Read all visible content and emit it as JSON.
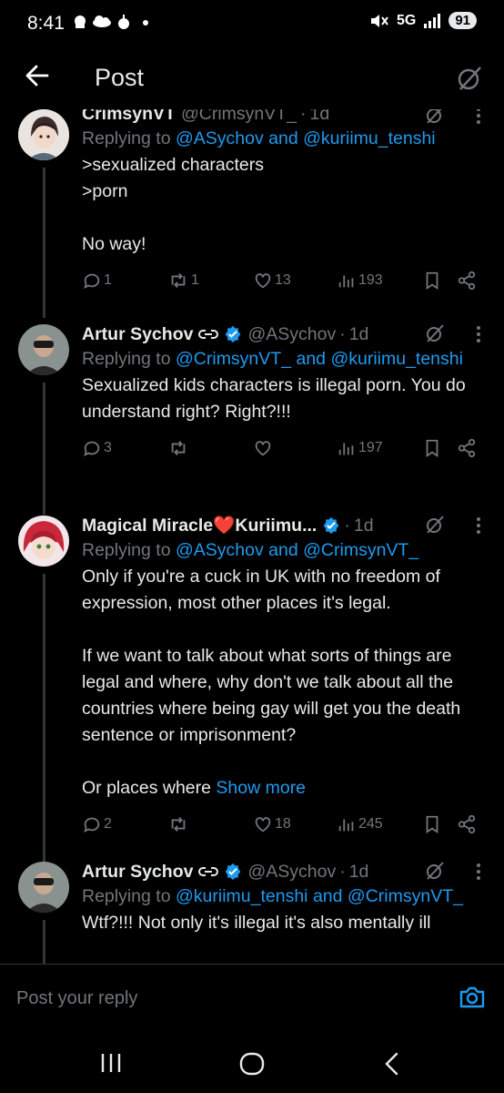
{
  "status_bar": {
    "time": "8:41",
    "network": "5G",
    "battery": "91"
  },
  "header": {
    "title": "Post"
  },
  "posts": [
    {
      "name": "CrimsynVT",
      "handle": "@CrimsynVT_",
      "time": "1d",
      "replying_prefix": "Replying to",
      "mentions": [
        "@ASychov",
        "@kuriimu_tenshi"
      ],
      "connector": "and",
      "text": ">sexualized characters\n>porn\n\nNo way!",
      "replies": "1",
      "reposts": "1",
      "likes": "13",
      "views": "193"
    },
    {
      "name": "Artur Sychov",
      "handle": "@ASychov",
      "time": "1d",
      "replying_prefix": "Replying to",
      "mentions": [
        "@CrimsynVT_",
        "@kuriimu_tenshi"
      ],
      "connector": "and",
      "text": "Sexualized kids characters is illegal porn. You do understand right? Right?!!!",
      "replies": "3",
      "reposts": "",
      "likes": "",
      "views": "197"
    },
    {
      "name": "Magical Miracle❤️Kuriimu...",
      "handle": "",
      "time": "1d",
      "replying_prefix": "Replying to",
      "mentions": [
        "@ASychov",
        "@CrimsynVT_"
      ],
      "connector": "and",
      "text": "Only if you're a cuck in UK with no freedom of expression, most other places it's legal.\n\nIf we want to talk about what sorts of things are legal and where, why don't we talk about all the countries where being gay will get you the death sentence or imprisonment?\n\nOr places where ",
      "show_more": "Show more",
      "replies": "2",
      "reposts": "",
      "likes": "18",
      "views": "245"
    },
    {
      "name": "Artur Sychov",
      "handle": "@ASychov",
      "time": "1d",
      "replying_prefix": "Replying to",
      "mentions": [
        "@kuriimu_tenshi",
        "@CrimsynVT_"
      ],
      "connector": "and",
      "text": "Wtf?!!! Not only it's illegal it's also mentally ill"
    }
  ],
  "reply_bar": {
    "placeholder": "Post your reply"
  },
  "icons": [
    "back-arrow-icon",
    "grok-icon",
    "more-icon",
    "reply-icon",
    "repost-icon",
    "like-icon",
    "views-icon",
    "bookmark-icon",
    "share-icon",
    "verified-icon",
    "camera-icon"
  ],
  "colors": {
    "background": "#000000",
    "text": "#e7e9ea",
    "muted": "#71767b",
    "accent": "#1d9bf0"
  }
}
